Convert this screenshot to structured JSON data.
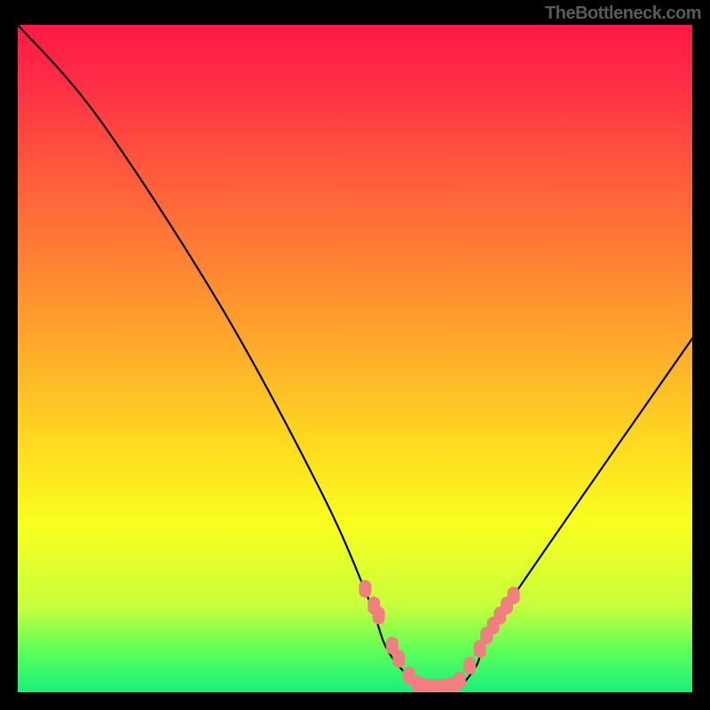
{
  "watermark": "TheBottleneck.com",
  "chart_data": {
    "type": "line",
    "title": "",
    "xlabel": "",
    "ylabel": "",
    "xlim": [
      0,
      100
    ],
    "ylim": [
      0,
      100
    ],
    "series": [
      {
        "name": "bottleneck-curve",
        "x": [
          0,
          12,
          30,
          45,
          52,
          55,
          60,
          62,
          65,
          68,
          70,
          80,
          100
        ],
        "y": [
          100,
          86,
          58,
          30,
          14,
          6,
          0.5,
          0.5,
          0.5,
          4,
          9,
          24,
          53
        ]
      }
    ],
    "markers": {
      "name": "salmon-beads",
      "color": "#f08080",
      "x": [
        51.5,
        52.8,
        53.5,
        55.5,
        56.5,
        58,
        59.3,
        60.3,
        61.5,
        62.5,
        63.5,
        64.5,
        65.5,
        67.0,
        68.5,
        69.5,
        70.5,
        71.5,
        72.5,
        73.5
      ],
      "y": [
        15.5,
        13.0,
        11.5,
        7.0,
        5.0,
        2.5,
        1.2,
        0.8,
        0.7,
        0.7,
        0.8,
        1.0,
        1.8,
        4.0,
        6.5,
        8.5,
        10.0,
        11.5,
        13.0,
        14.5
      ]
    },
    "gradient_colors": {
      "top": "#ff1846",
      "mid_upper": "#ff8a32",
      "mid": "#ffe11e",
      "mid_lower": "#c8ff3c",
      "bottom": "#18f07c"
    }
  }
}
